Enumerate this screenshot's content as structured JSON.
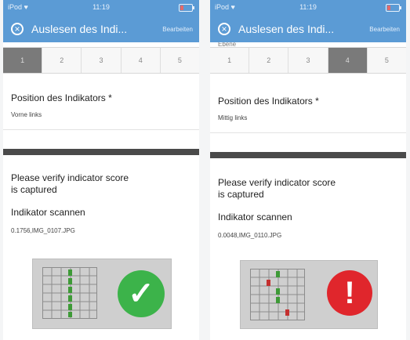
{
  "phones": [
    {
      "status": {
        "carrier": "iPod ♥",
        "time": "11:19"
      },
      "nav": {
        "title": "Auslesen des Indi...",
        "edit_label": "Bearbeiten",
        "close_icon": "close-circle-icon"
      },
      "tabs": [
        {
          "label": "1",
          "active": true
        },
        {
          "label": "2",
          "active": false
        },
        {
          "label": "3",
          "active": false
        },
        {
          "label": "4",
          "active": false
        },
        {
          "label": "5",
          "active": false
        }
      ],
      "position": {
        "label": "Position des Indikators *",
        "value": "Vorne links"
      },
      "verify_prompt": "Please verify indicator score\nis captured",
      "scan": {
        "label": "Indikator scannen",
        "value": "0.1756,IMG_0107.JPG"
      },
      "result": {
        "status": "ok",
        "icon": "checkmark-icon",
        "color": "#3cb34a"
      }
    },
    {
      "status": {
        "carrier": "iPod ♥",
        "time": "11:19"
      },
      "nav": {
        "title": "Auslesen des Indi...",
        "edit_label": "Bearbeiten",
        "close_icon": "close-circle-icon"
      },
      "subline": "Ebene",
      "tabs": [
        {
          "label": "1",
          "active": false
        },
        {
          "label": "2",
          "active": false
        },
        {
          "label": "3",
          "active": false
        },
        {
          "label": "4",
          "active": true
        },
        {
          "label": "5",
          "active": false
        }
      ],
      "position": {
        "label": "Position des Indikators *",
        "value": "Mittig links"
      },
      "verify_prompt": "Please verify indicator score\nis captured",
      "scan": {
        "label": "Indikator scannen",
        "value": "0.0048,IMG_0110.JPG"
      },
      "result": {
        "status": "error",
        "icon": "exclamation-icon",
        "color": "#e0262c"
      }
    }
  ],
  "colors": {
    "header": "#5b9bd5",
    "active_tab": "#7a7a7a",
    "grid_green": "#3e9a37",
    "grid_red": "#c4302f"
  }
}
